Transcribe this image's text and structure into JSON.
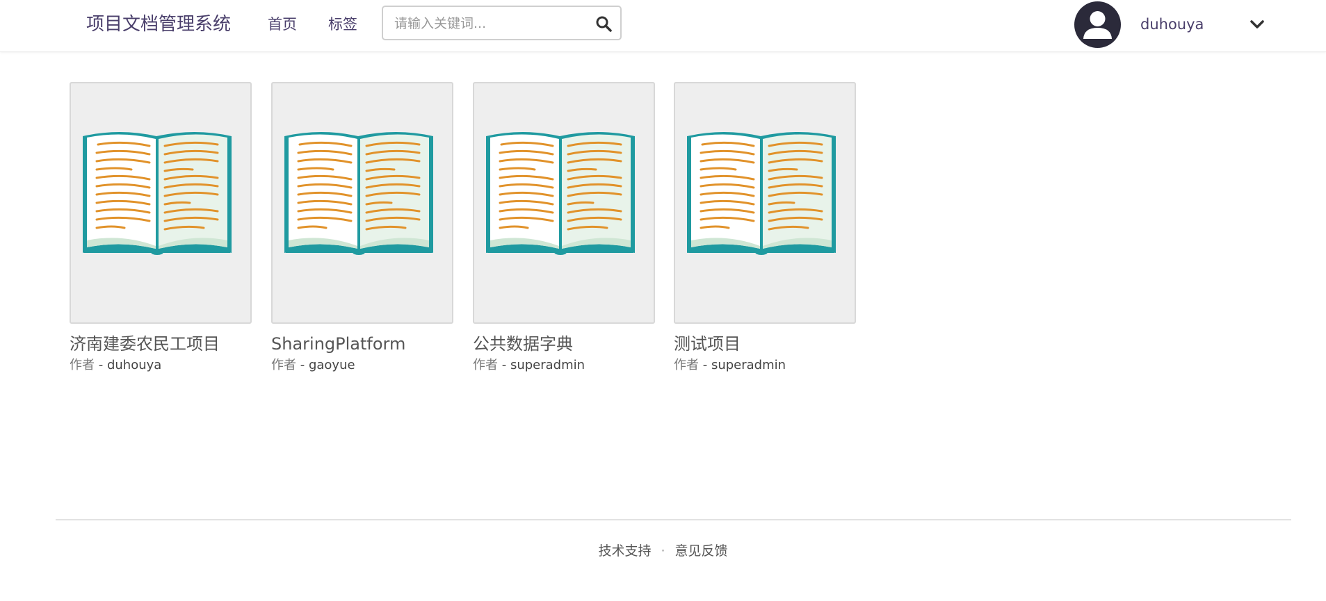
{
  "nav": {
    "brand": "项目文档管理系统",
    "home": "首页",
    "tags": "标签",
    "search_placeholder": "请输入关键词..."
  },
  "user": {
    "name": "duhouya"
  },
  "projects": [
    {
      "title": "济南建委农民工项目",
      "author_label": "作者",
      "author": "- duhouya"
    },
    {
      "title": "SharingPlatform",
      "author_label": "作者",
      "author": "- gaoyue"
    },
    {
      "title": "公共数据字典",
      "author_label": "作者",
      "author": "- superadmin"
    },
    {
      "title": "测试项目",
      "author_label": "作者",
      "author": "- superadmin"
    }
  ],
  "footer": {
    "support": "技术支持",
    "separator": "·",
    "feedback": "意见反馈"
  },
  "colors": {
    "brand": "#4a3f6b",
    "book_teal": "#1f9aa0",
    "book_lines": "#e1922a"
  }
}
